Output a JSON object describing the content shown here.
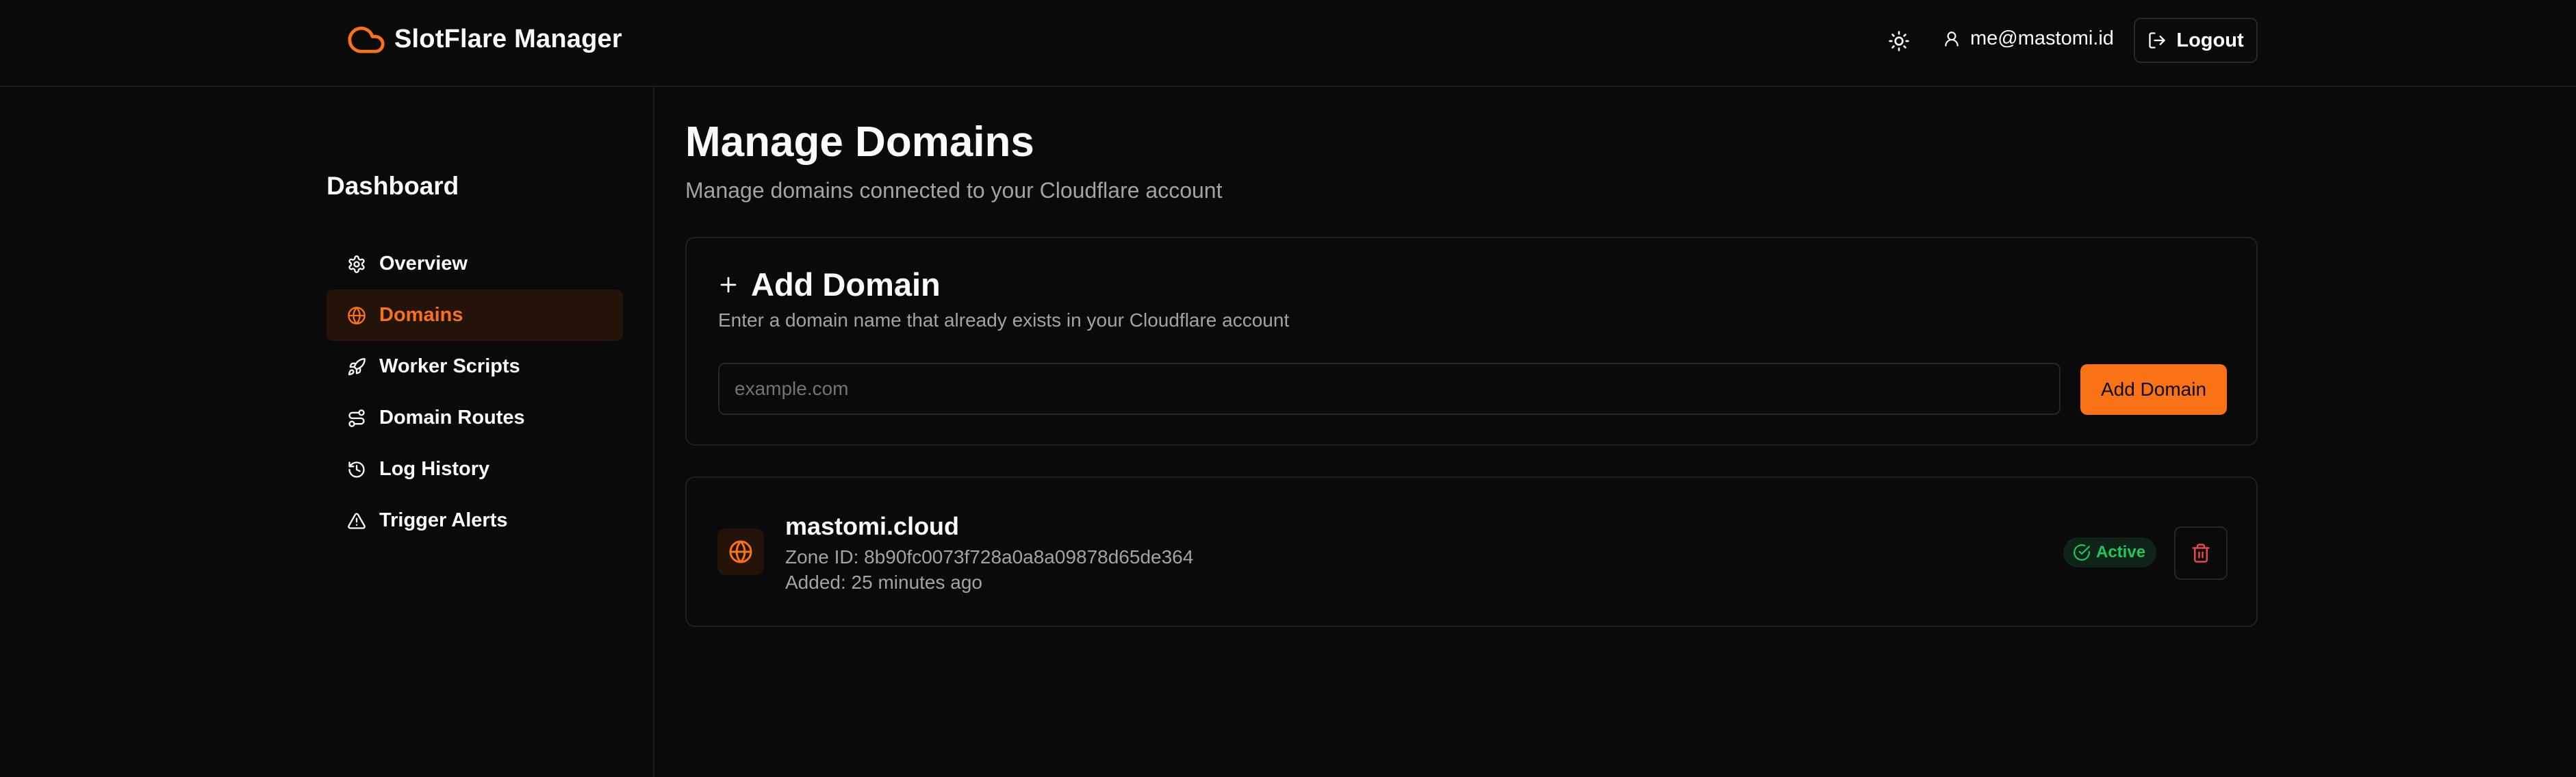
{
  "header": {
    "brand": "SlotFlare Manager",
    "user_email": "me@mastomi.id",
    "logout_label": "Logout"
  },
  "sidebar": {
    "title": "Dashboard",
    "items": [
      {
        "label": "Overview",
        "icon": "gear-icon",
        "active": false
      },
      {
        "label": "Domains",
        "icon": "globe-icon",
        "active": true
      },
      {
        "label": "Worker Scripts",
        "icon": "rocket-icon",
        "active": false
      },
      {
        "label": "Domain Routes",
        "icon": "route-icon",
        "active": false
      },
      {
        "label": "Log History",
        "icon": "history-icon",
        "active": false
      },
      {
        "label": "Trigger Alerts",
        "icon": "alert-triangle-icon",
        "active": false
      }
    ]
  },
  "main": {
    "title": "Manage Domains",
    "subtitle": "Manage domains connected to your Cloudflare account",
    "add_card": {
      "title": "Add Domain",
      "description": "Enter a domain name that already exists in your Cloudflare account",
      "input_placeholder": "example.com",
      "input_value": "",
      "button_label": "Add Domain"
    },
    "domains": [
      {
        "name": "mastomi.cloud",
        "zone_id": "Zone ID: 8b90fc0073f728a0a8a09878d65de364",
        "added": "Added: 25 minutes ago",
        "status": "Active"
      }
    ]
  },
  "colors": {
    "background": "#0a0a0a",
    "accent": "#f97316",
    "success": "#22c55e",
    "danger": "#ef4444",
    "muted_text": "#a3a3a3",
    "border": "#262626"
  }
}
